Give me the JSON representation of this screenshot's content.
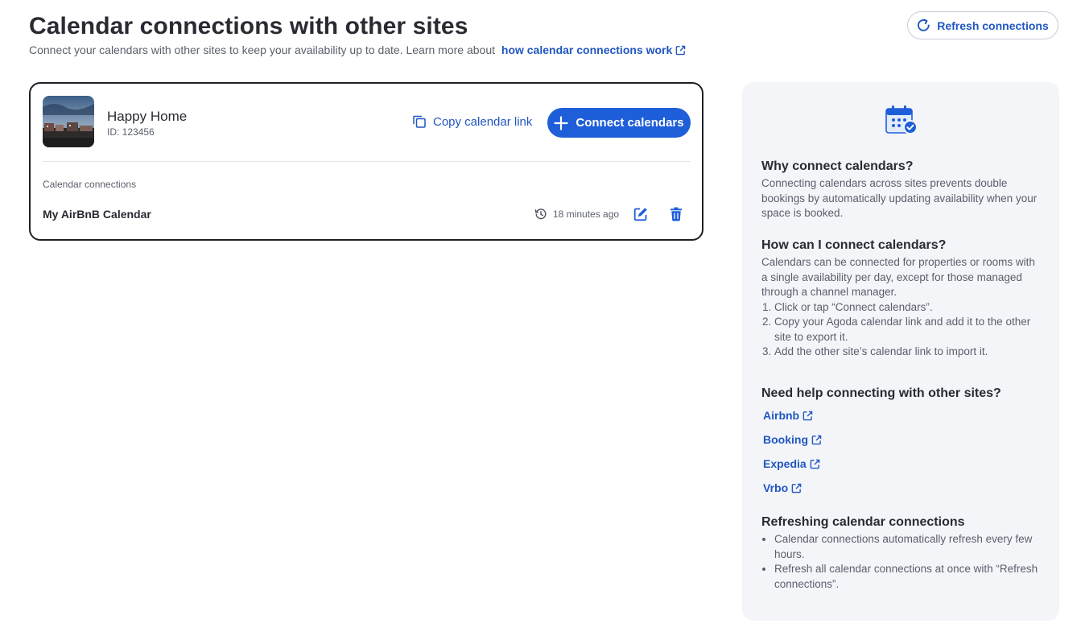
{
  "header": {
    "title": "Calendar connections with other sites",
    "subtitle": "Connect your calendars with other sites to keep your availability up to date. Learn more about",
    "learn_link": "how calendar connections work",
    "refresh_label": "Refresh connections"
  },
  "property": {
    "name": "Happy Home",
    "id": "ID: 123456",
    "copy_link_label": "Copy calendar link",
    "connect_label": "Connect calendars",
    "connections_label": "Calendar connections",
    "connections": [
      {
        "name": "My AirBnB Calendar",
        "last_sync": "18 minutes ago"
      }
    ]
  },
  "help": {
    "why": {
      "title": "Why connect calendars?",
      "body": "Connecting calendars across sites prevents double bookings by automatically updating availability when your space is booked."
    },
    "how": {
      "title": "How can I connect calendars?",
      "body": "Calendars can be connected for properties or rooms with a single availability per day, except for those managed through a channel manager.",
      "steps": [
        "Click or tap “Connect calendars”.",
        "Copy your Agoda calendar link and add it to the other site to export it.",
        "Add the other site’s calendar link to import it."
      ]
    },
    "sites": {
      "title": "Need help connecting with other sites?",
      "links": [
        "Airbnb",
        "Booking",
        "Expedia",
        "Vrbo"
      ]
    },
    "refreshing": {
      "title": "Refreshing calendar connections",
      "bullets": [
        "Calendar connections automatically refresh every few hours.",
        "Refresh all calendar connections at once with “Refresh connections”."
      ]
    }
  },
  "colors": {
    "accent": "#1f5ed9",
    "link": "#2156c2",
    "panel_bg": "#f3f5f9",
    "text": "#2a2a33",
    "muted": "#5a5f6b"
  }
}
